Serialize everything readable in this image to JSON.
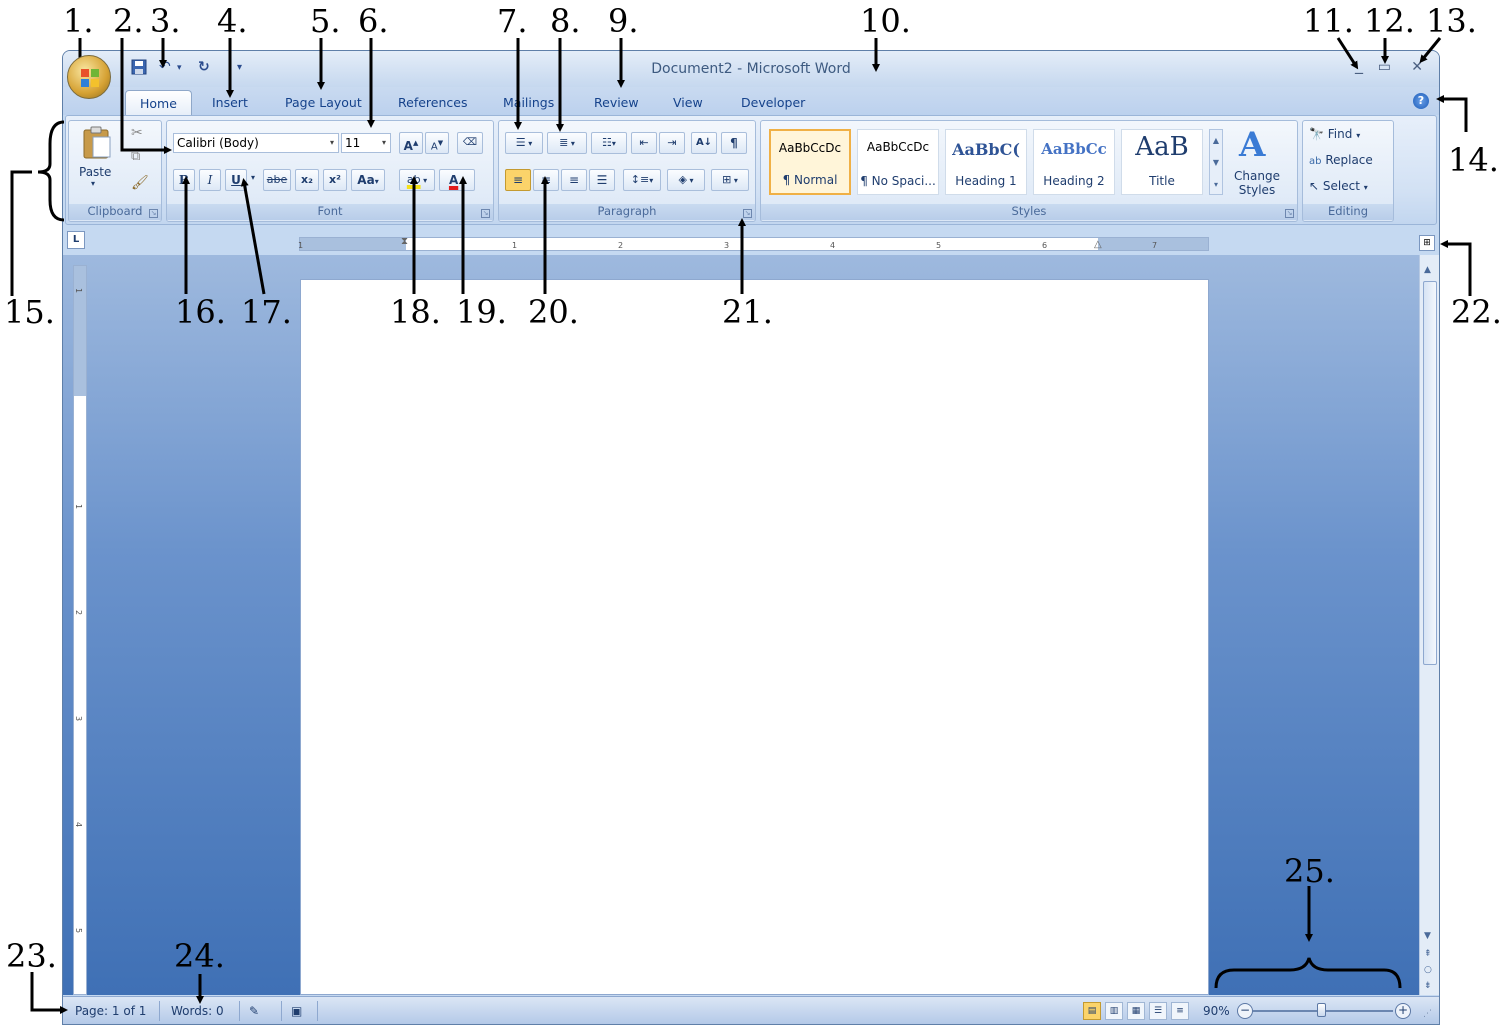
{
  "window": {
    "title": "Document2 - Microsoft Word",
    "minimize_icon": "minimize-icon",
    "maximize_icon": "maximize-icon",
    "close_icon": "close-icon",
    "help_icon": "help-icon",
    "help_label": "?"
  },
  "tabs": [
    "Home",
    "Insert",
    "Page Layout",
    "References",
    "Mailings",
    "Review",
    "View",
    "Developer"
  ],
  "active_tab": "Home",
  "clipboard": {
    "paste_label": "Paste",
    "group_label": "Clipboard"
  },
  "font": {
    "font_name": "Calibri (Body)",
    "font_size": "11",
    "bold": "B",
    "italic": "I",
    "underline": "U",
    "strikethrough": "abe",
    "subscript": "x₂",
    "superscript": "x²",
    "change_case": "Aa",
    "grow": "A",
    "shrink": "A",
    "highlight": "ab",
    "font_color": "A",
    "group_label": "Font",
    "highlight_color": "#f5e11a",
    "font_color_value": "#e21b1b"
  },
  "paragraph": {
    "group_label": "Paragraph",
    "show_marks": "¶",
    "sort": "A↓"
  },
  "styles": {
    "items": [
      {
        "sample": "AaBbCcDc",
        "name": "¶ Normal"
      },
      {
        "sample": "AaBbCcDc",
        "name": "¶ No Spaci..."
      },
      {
        "sample": "AaBbC(",
        "name": "Heading 1"
      },
      {
        "sample": "AaBbCc",
        "name": "Heading 2"
      },
      {
        "sample": "AaB",
        "name": "Title"
      }
    ],
    "change_styles": "Change Styles",
    "group_label": "Styles"
  },
  "editing": {
    "find": "Find",
    "replace": "Replace",
    "select": "Select",
    "group_label": "Editing"
  },
  "ruler": {
    "tab_selector": "L",
    "marks": [
      "1",
      "1",
      "2",
      "3",
      "4",
      "5",
      "6",
      "7"
    ],
    "vmarks": [
      "1",
      "1",
      "2",
      "3",
      "4",
      "5"
    ]
  },
  "status": {
    "page": "Page: 1 of 1",
    "words": "Words: 0",
    "zoom": "90%",
    "zoom_minus": "−",
    "zoom_plus": "+"
  },
  "callouts": [
    "1.",
    "2.",
    "3.",
    "4.",
    "5.",
    "6.",
    "7.",
    "8.",
    "9.",
    "10.",
    "11.",
    "12.",
    "13.",
    "14.",
    "15.",
    "16.",
    "17.",
    "18.",
    "19.",
    "20.",
    "21.",
    "22.",
    "23.",
    "24.",
    "25."
  ]
}
